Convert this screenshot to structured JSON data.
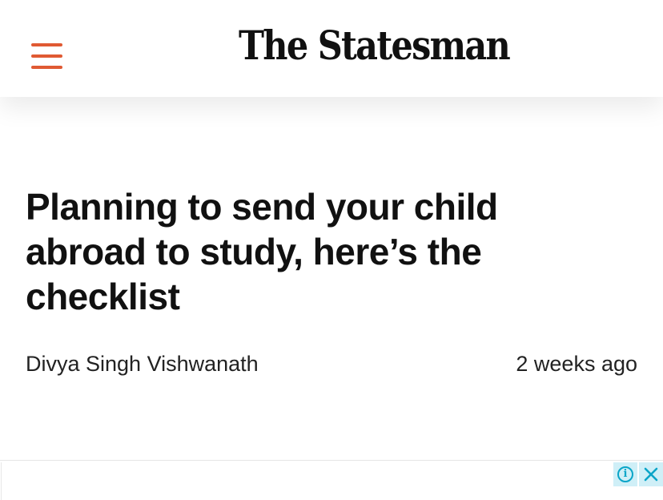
{
  "header": {
    "brand": "The Statesman",
    "accent_color": "#e05a33",
    "menu_icon": "hamburger-menu-icon"
  },
  "article": {
    "headline": "Planning to send your child abroad to study, here’s the checklist",
    "author": "Divya Singh Vishwanath",
    "published": "2 weeks ago"
  },
  "ad": {
    "info_icon": "info-icon",
    "close_icon": "close-icon",
    "info_color": "#0aa5c8"
  }
}
